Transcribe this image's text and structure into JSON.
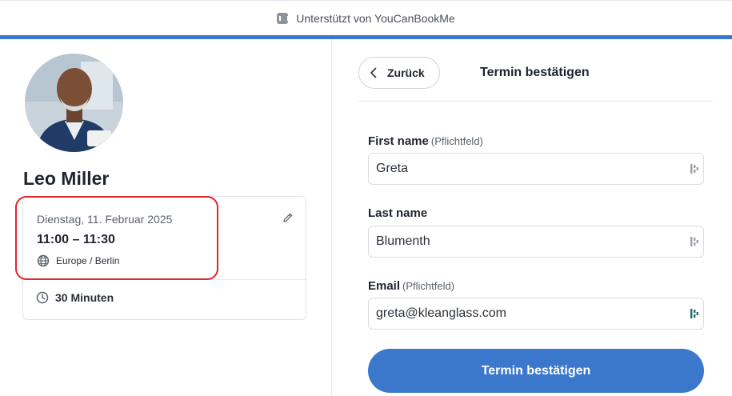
{
  "header": {
    "powered_by": "Unterstützt von YouCanBookMe",
    "accent_color": "#3b78cc"
  },
  "host": {
    "name": "Leo Miller",
    "avatar": "host-portrait"
  },
  "booking": {
    "date": "Dienstag, 11. Februar 2025",
    "time": "11:00 – 11:30",
    "timezone": "Europe / Berlin",
    "duration": "30 Minuten",
    "highlight_color": "#e0272d"
  },
  "form": {
    "back_label": "Zurück",
    "title": "Termin bestätigen",
    "fields": [
      {
        "label": "First name",
        "required_note": "(Pflichtfeld)",
        "value": "Greta"
      },
      {
        "label": "Last name",
        "required_note": "",
        "value": "Blumenth"
      },
      {
        "label": "Email",
        "required_note": "(Pflichtfeld)",
        "value": "greta@kleanglass.com"
      }
    ],
    "submit_label": "Termin bestätigen"
  }
}
